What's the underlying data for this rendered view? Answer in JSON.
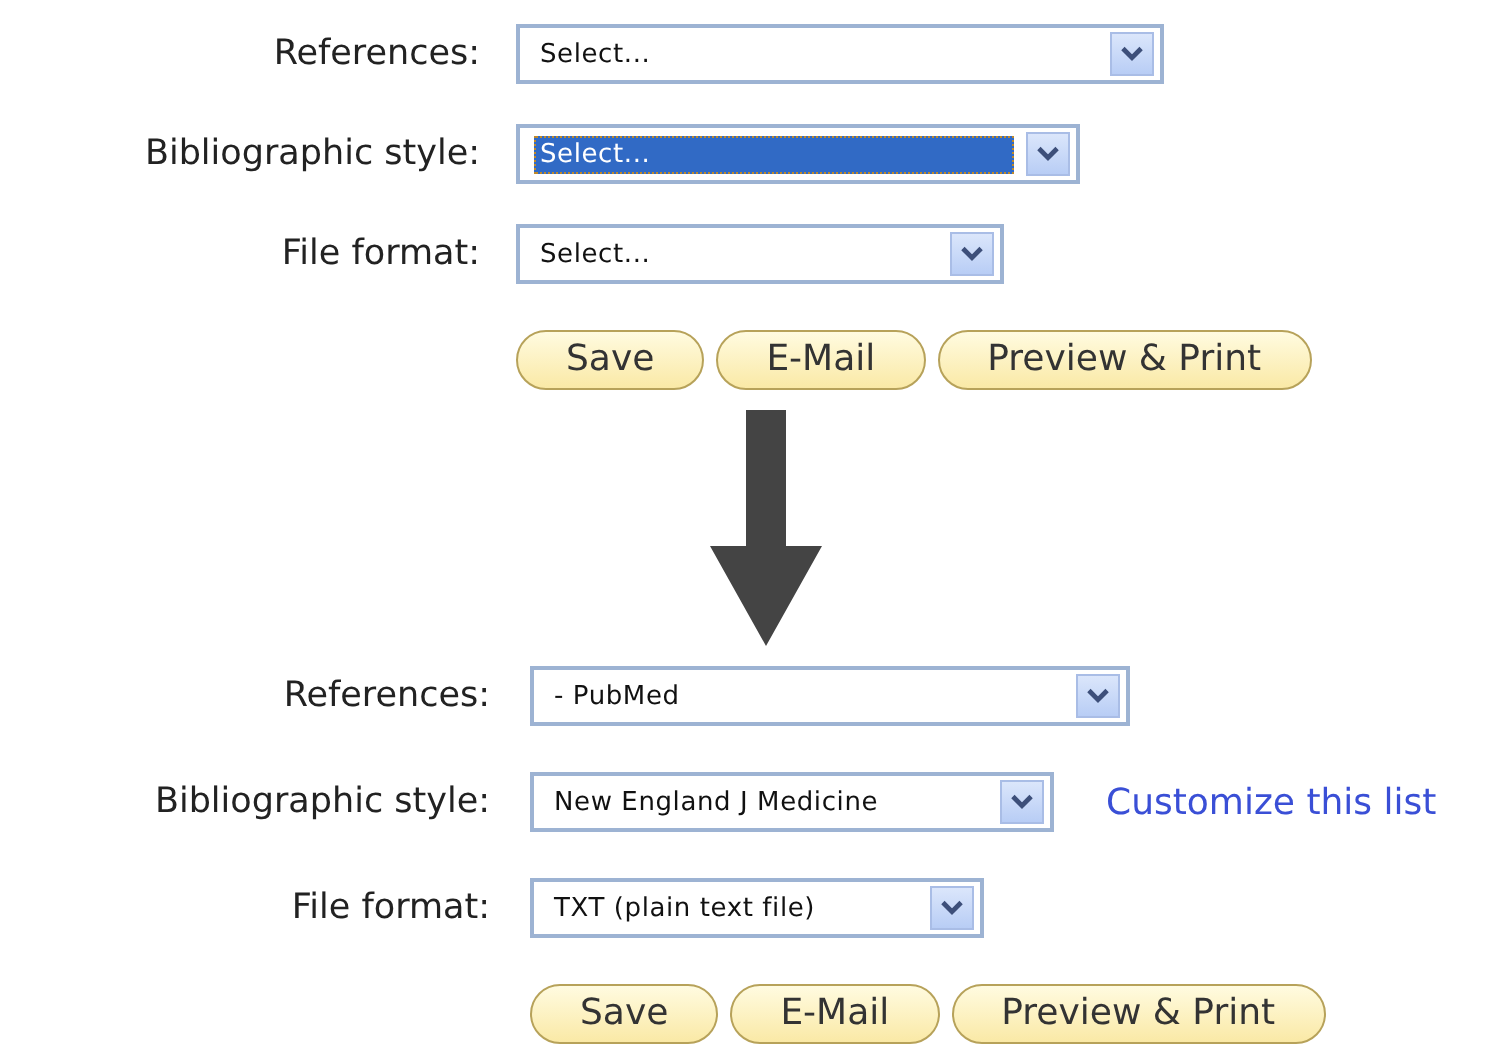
{
  "panels": [
    {
      "fields": [
        {
          "label": "References:",
          "value": "Select...",
          "focused": false
        },
        {
          "label": "Bibliographic style:",
          "value": "Select...",
          "focused": true
        },
        {
          "label": "File format:",
          "value": "Select...",
          "focused": false
        }
      ],
      "buttons": [
        "Save",
        "E-Mail",
        "Preview & Print"
      ]
    },
    {
      "fields": [
        {
          "label": "References:",
          "value": "- PubMed",
          "focused": false
        },
        {
          "label": "Bibliographic style:",
          "value": "New England J Medicine",
          "focused": false,
          "link": "Customize this list"
        },
        {
          "label": "File format:",
          "value": "TXT (plain text file)",
          "focused": false
        }
      ],
      "buttons": [
        "Save",
        "E-Mail",
        "Preview & Print"
      ]
    }
  ]
}
